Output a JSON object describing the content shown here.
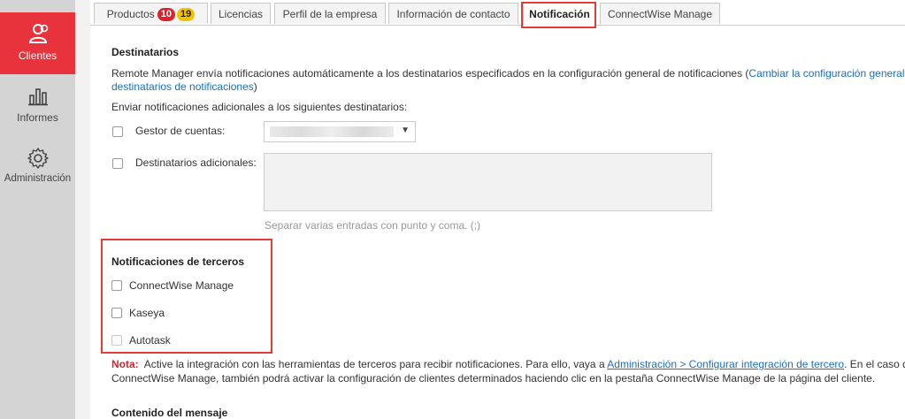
{
  "nav": {
    "items": [
      {
        "label": "Clientes",
        "icon": "users-icon",
        "active": true
      },
      {
        "label": "Informes",
        "icon": "bar-chart-icon",
        "active": false
      },
      {
        "label": "Administración",
        "icon": "gear-icon",
        "active": false
      }
    ]
  },
  "tabs": {
    "productos": "Productos",
    "badge_red": "10",
    "badge_yellow": "19",
    "licencias": "Licencias",
    "perfil": "Perfil de la empresa",
    "contacto": "Información de contacto",
    "notificacion": "Notificación",
    "connectwise": "ConnectWise Manage"
  },
  "destinatarios": {
    "heading": "Destinatarios",
    "description": "Remote Manager envía notificaciones automáticamente a los destinatarios especificados en la configuración general de notificaciones (",
    "link_part1": "Cambiar la configuración general de",
    "link_part2": "destinatarios de notificaciones",
    "close_paren": ")",
    "additional_intro": "Enviar notificaciones adicionales a los siguientes destinatarios:",
    "account_manager_label": "Gestor de cuentas:",
    "additional_recipients_label": "Destinatarios adicionales:",
    "separator_hint": "Separar varias entradas con punto y coma. (;)"
  },
  "third_party": {
    "heading": "Notificaciones de terceros",
    "options": [
      "ConnectWise Manage",
      "Kaseya",
      "Autotask"
    ]
  },
  "note": {
    "label": "Nota:",
    "text1": "Active la integración con las herramientas de terceros para recibir notificaciones. Para ello, vaya a",
    "link": "Administración > Configurar integración de tercero",
    "text2": ". En el caso de",
    "text3": "ConnectWise Manage, también podrá activar la configuración de clientes determinados haciendo clic en la pestaña ConnectWise Manage de la página del cliente."
  },
  "message": {
    "heading": "Contenido del mensaje"
  },
  "colors": {
    "accent": "#e8323c",
    "link": "#1a6fc0",
    "highlight": "#e23b3b"
  }
}
